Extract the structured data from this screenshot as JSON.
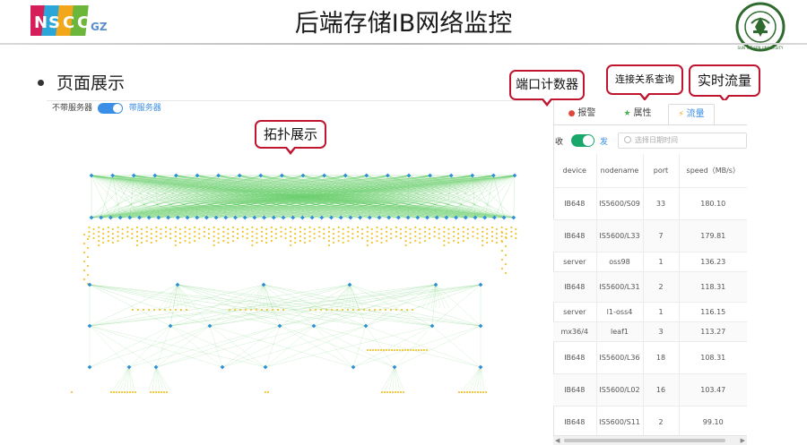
{
  "slide": {
    "title": "后端存储IB网络监控",
    "bullet": "页面展示",
    "left_logo_letters": [
      "N",
      "S",
      "C",
      "C",
      "GZ"
    ],
    "right_logo_text": "SUN YAT-SEN UNIVERSITY"
  },
  "callouts": {
    "topology": "拓扑展示",
    "port_counter": "端口计数器",
    "connection_query": "连接关系查询",
    "realtime_flow": "实时流量"
  },
  "topology": {
    "toggle_off_label": "不带服务器",
    "toggle_on_label": "带服务器",
    "colors": {
      "node": "#2f8fd6",
      "link": "#56c85a",
      "server": "#f2c531"
    }
  },
  "panel": {
    "tabs": [
      {
        "label": "报警",
        "icon": "alarm-icon"
      },
      {
        "label": "属性",
        "icon": "star-icon"
      },
      {
        "label": "流量",
        "icon": "bolt-icon"
      }
    ],
    "filter": {
      "recv_label": "收",
      "send_label": "发",
      "date_placeholder": "选择日期时间"
    },
    "columns": [
      "device",
      "nodename",
      "port",
      "speed（MB/s）"
    ],
    "rows": [
      {
        "device": "IB648",
        "nodename": "IS5600/S09",
        "port": "33",
        "speed": "180.10"
      },
      {
        "device": "IB648",
        "nodename": "IS5600/L33",
        "port": "7",
        "speed": "179.81"
      },
      {
        "device": "server",
        "nodename": "oss98",
        "port": "1",
        "speed": "136.23"
      },
      {
        "device": "IB648",
        "nodename": "IS5600/L31",
        "port": "2",
        "speed": "118.31"
      },
      {
        "device": "server",
        "nodename": "l1-oss4",
        "port": "1",
        "speed": "116.15"
      },
      {
        "device": "mx36/4",
        "nodename": "leaf1",
        "port": "3",
        "speed": "113.27"
      },
      {
        "device": "IB648",
        "nodename": "IS5600/L36",
        "port": "18",
        "speed": "108.31"
      },
      {
        "device": "IB648",
        "nodename": "IS5600/L02",
        "port": "16",
        "speed": "103.47"
      },
      {
        "device": "IB648",
        "nodename": "IS5600/S11",
        "port": "2",
        "speed": "99.10"
      }
    ]
  }
}
